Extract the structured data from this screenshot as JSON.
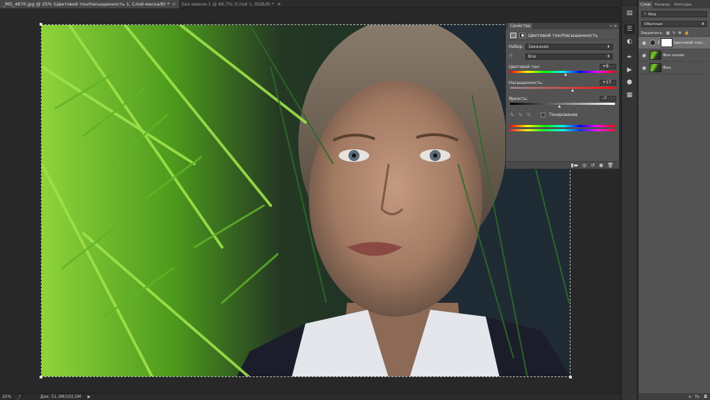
{
  "tabs": [
    {
      "label": "_MG_4670.jpg @ 25% (Цветовой тон/Насыщенность 1, Слой-маска/8) *",
      "active": true
    },
    {
      "label": "Без имени-1 @ 66,7% (Слой 1, RGB/8) *",
      "active": false
    }
  ],
  "tab_close": "×",
  "status": {
    "zoom": "25%",
    "export_icon": "export-icon",
    "doc_label": "Док: 51,3M/102,5M",
    "arrow": "▶"
  },
  "properties": {
    "panel_title": "Свойства",
    "adjustment_title": "Цветовой тон/Насыщенность",
    "preset_label": "Набор:",
    "preset_value": "Заказная",
    "channel_value": "Все",
    "hue_label": "Цветовой тон:",
    "hue_value": "+9",
    "hue": 9,
    "saturation_label": "Насыщенность:",
    "saturation_value": "+17",
    "saturation": 17,
    "lightness_label": "Яркость:",
    "lightness_value": "-7",
    "lightness": -7,
    "colorize_label": "Тонирование",
    "colorize_checked": false
  },
  "layers_panel": {
    "tabs": [
      "Слои",
      "Каналы",
      "Контуры"
    ],
    "active_tab": 0,
    "filter_label": "Вид",
    "blend_mode": "Обычные",
    "lock_label": "Закрепить:",
    "layers": [
      {
        "name": "Цветовой тон/...",
        "type": "adjustment",
        "selected": true
      },
      {
        "name": "Фон копия",
        "type": "image",
        "selected": false
      },
      {
        "name": "Фон",
        "type": "image",
        "selected": false
      }
    ]
  },
  "colors": {
    "accent_rainbow": [
      "#ff0000",
      "#ffff00",
      "#00ff00",
      "#00ffff",
      "#0000ff",
      "#ff00ff",
      "#ff0000"
    ]
  }
}
